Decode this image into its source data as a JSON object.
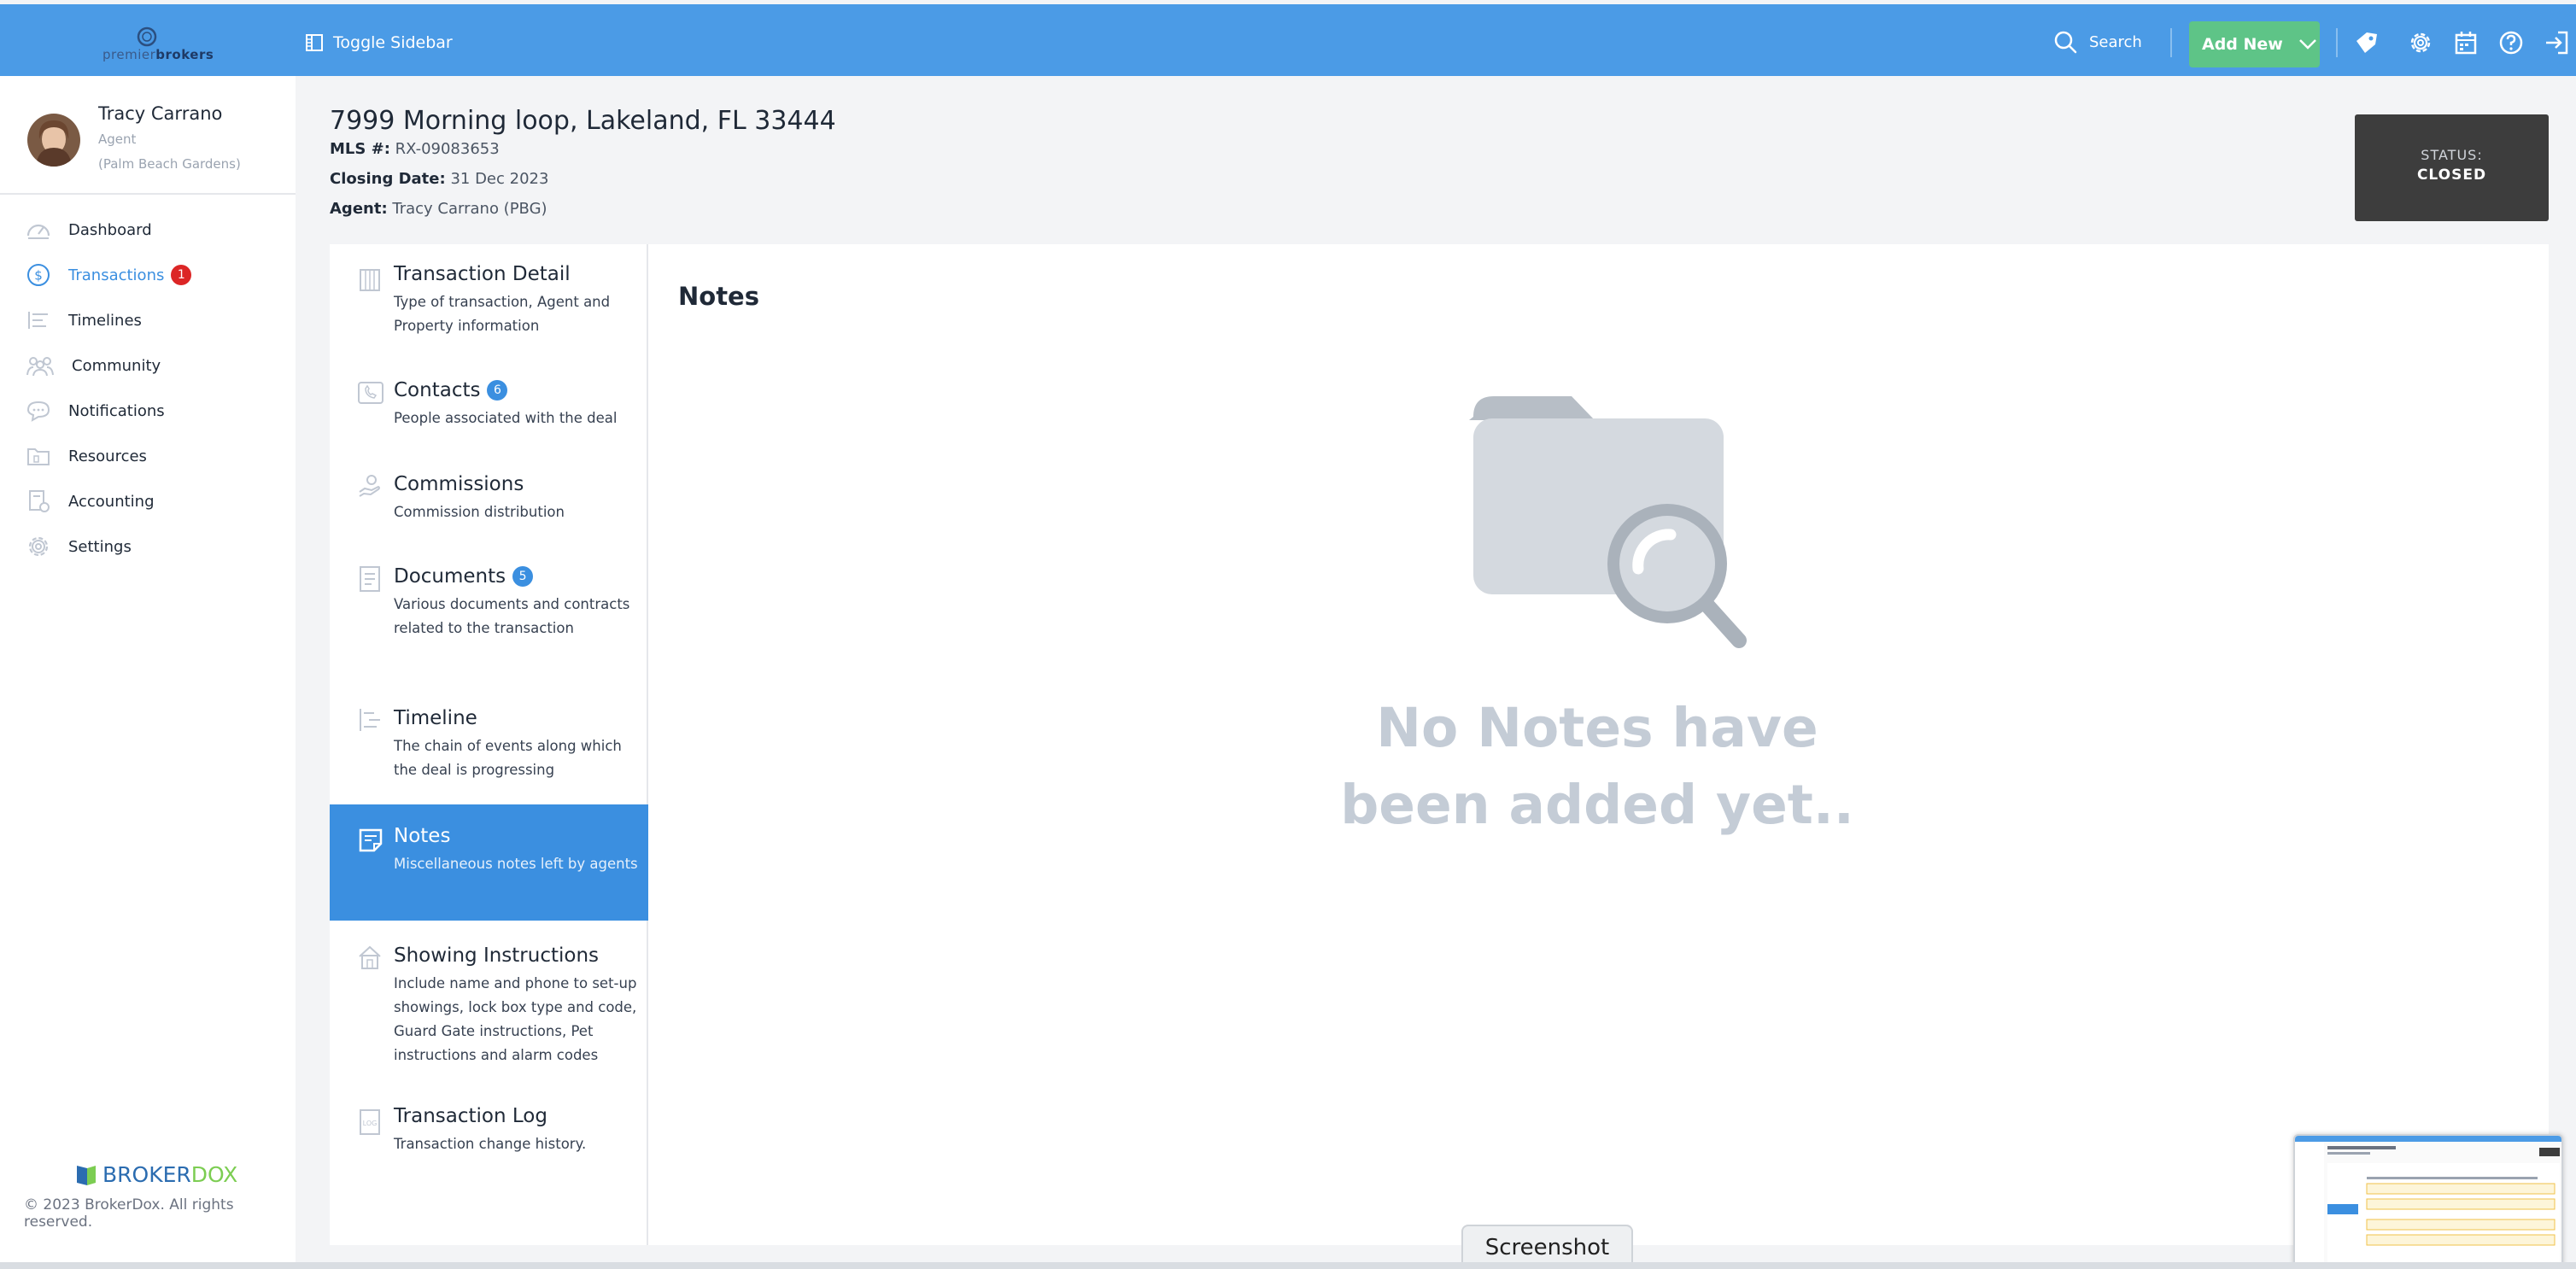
{
  "topbar": {
    "logo_text_a": "premier",
    "logo_text_b": "brokers",
    "toggle_sidebar_label": "Toggle Sidebar",
    "search_label": "Search",
    "add_new_label": "Add New",
    "icons": [
      "tag-icon",
      "gear-icon",
      "calendar-icon",
      "help-icon",
      "logout-icon"
    ]
  },
  "user": {
    "name": "Tracy Carrano",
    "role": "Agent",
    "office": "(Palm Beach Gardens)"
  },
  "sidebar": {
    "items": [
      {
        "label": "Dashboard",
        "icon": "gauge-icon"
      },
      {
        "label": "Transactions",
        "icon": "dollar-icon",
        "badge": "1"
      },
      {
        "label": "Timelines",
        "icon": "timeline-icon"
      },
      {
        "label": "Community",
        "icon": "people-icon"
      },
      {
        "label": "Notifications",
        "icon": "chat-icon"
      },
      {
        "label": "Resources",
        "icon": "folder-icon"
      },
      {
        "label": "Accounting",
        "icon": "accounting-icon"
      },
      {
        "label": "Settings",
        "icon": "gear-icon"
      }
    ],
    "brand_a": "BROKER",
    "brand_b": "DOX",
    "copyright": "© 2023 BrokerDox. All rights reserved."
  },
  "transaction": {
    "address": "7999 Morning loop, Lakeland, FL 33444",
    "mls_label": "MLS #:",
    "mls_value": "RX-09083653",
    "closing_label": "Closing Date:",
    "closing_value": "31 Dec 2023",
    "agent_label": "Agent:",
    "agent_value": "Tracy Carrano (PBG)",
    "status_label": "STATUS:",
    "status_value": "CLOSED"
  },
  "menu": {
    "items": [
      {
        "title": "Transaction Detail",
        "desc": "Type of transaction, Agent and Property information"
      },
      {
        "title": "Contacts",
        "desc": "People associated with the deal",
        "count": "6"
      },
      {
        "title": "Commissions",
        "desc": "Commission distribution"
      },
      {
        "title": "Documents",
        "desc": "Various documents and contracts related to the transaction",
        "count": "5"
      },
      {
        "title": "Timeline",
        "desc": "The chain of events along which the deal is progressing"
      },
      {
        "title": "Notes",
        "desc": "Miscellaneous notes left by agents"
      },
      {
        "title": "Showing Instructions",
        "desc": "Include name and phone to set-up showings, lock box type and code, Guard Gate instructions, Pet instructions and alarm codes"
      },
      {
        "title": "Transaction Log",
        "desc": "Transaction change history."
      }
    ],
    "selected": "Notes"
  },
  "notes": {
    "title": "Notes",
    "empty_message": "No Notes have been added yet.."
  },
  "overlay": {
    "screenshot_label": "Screenshot"
  },
  "colors": {
    "topbar": "#4b9be6",
    "accent": "#3b8fe0",
    "add_new": "#5ec487",
    "status_box": "#3d3d3d",
    "badge_red": "#dc2626"
  }
}
